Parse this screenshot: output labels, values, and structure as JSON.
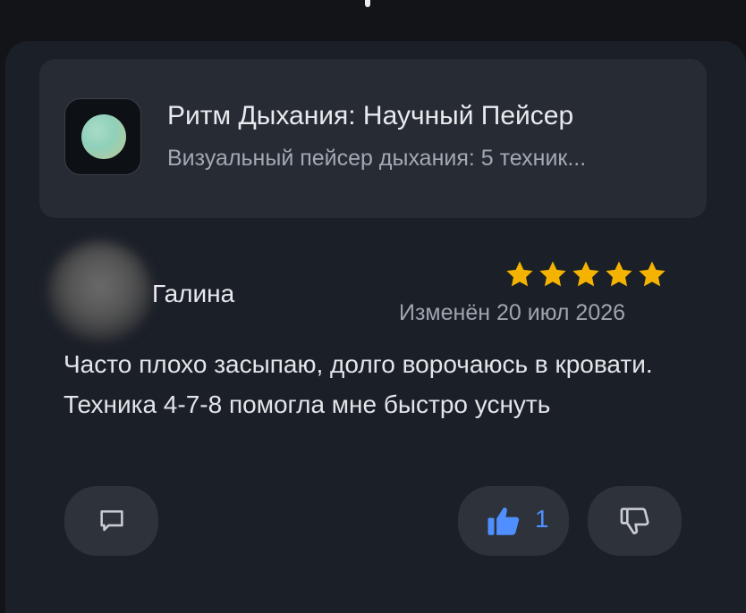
{
  "app": {
    "name": "Ритм Дыхания: Научный Пейсер",
    "subtitle": "Визуальный пейсер дыхания: 5 техник...",
    "icon": "breathing-orb-icon"
  },
  "review": {
    "author": "Галина",
    "rating": 5,
    "rating_max": 5,
    "date": "Изменён 20 июл 2026",
    "text": "Часто плохо засыпаю, долго ворочаюсь в кровати. Техника 4-7-8 помогла мне быстро уснуть"
  },
  "actions": {
    "comment_icon": "comment-icon",
    "like_icon": "thumbs-up-icon",
    "like_count": "1",
    "dislike_icon": "thumbs-down-icon"
  },
  "colors": {
    "background": "#121418",
    "card": "#1b1f27",
    "tile": "#272b34",
    "star": "#f5b301",
    "like_accent": "#4f8fff"
  }
}
